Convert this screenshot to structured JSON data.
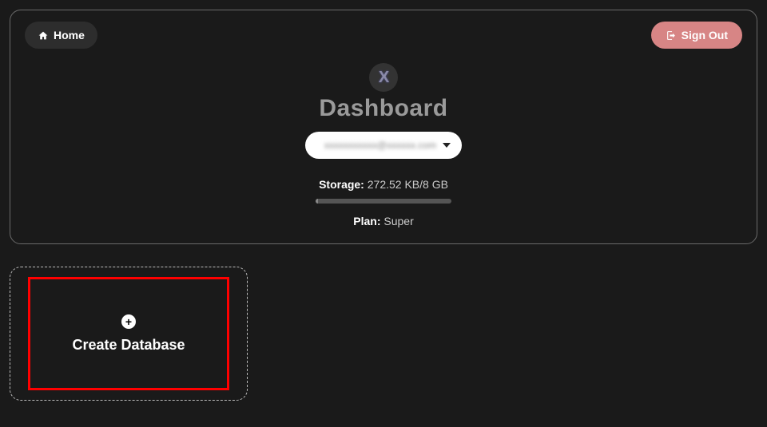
{
  "header": {
    "home_label": "Home",
    "signout_label": "Sign Out"
  },
  "dashboard": {
    "logo_letter": "X",
    "title": "Dashboard",
    "account_display": "xxxxxxxxxxx@xxxxxx.com",
    "storage_label": "Storage:",
    "storage_value": "272.52 KB/8 GB",
    "plan_label": "Plan:",
    "plan_value": "Super"
  },
  "card": {
    "create_label": "Create Database"
  }
}
